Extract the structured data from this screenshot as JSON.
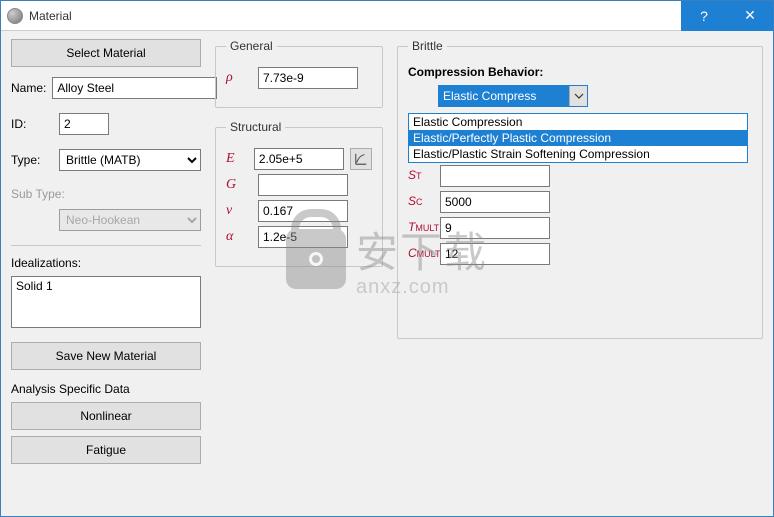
{
  "window": {
    "title": "Material"
  },
  "left": {
    "select_material": "Select Material",
    "name_label": "Name:",
    "name_value": "Alloy Steel",
    "id_label": "ID:",
    "id_value": "2",
    "type_label": "Type:",
    "type_value": "Brittle (MATB)",
    "subtype_label": "Sub Type:",
    "subtype_value": "Neo-Hookean",
    "idealizations_label": "Idealizations:",
    "idealizations_value": "Solid 1",
    "save_new": "Save New Material",
    "analysis_label": "Analysis Specific Data",
    "nonlinear": "Nonlinear",
    "fatigue": "Fatigue"
  },
  "general": {
    "legend": "General",
    "rho_sym": "ρ",
    "rho_value": "7.73e-9"
  },
  "structural": {
    "legend": "Structural",
    "E_sym": "E",
    "E_value": "2.05e+5",
    "G_sym": "G",
    "G_value": "",
    "nu_sym": "ν",
    "nu_value": "0.167",
    "alpha_sym": "α",
    "alpha_value": "1.2e-5"
  },
  "brittle": {
    "legend": "Brittle",
    "cb_label": "Compression Behavior:",
    "cb_selected": "Elastic Compress",
    "cb_options": [
      "Elastic Compression",
      "Elastic/Perfectly Plastic Compression",
      "Elastic/Plastic Strain Softening Compression"
    ],
    "cb_highlight_index": 1,
    "S_T_label": "S",
    "S_T_sub": "T",
    "S_T_value": "",
    "S_C_label": "S",
    "S_C_sub": "C",
    "S_C_value": "5000",
    "Tmult_label": "T",
    "Tmult_sub": "MULT",
    "Tmult_value": "9",
    "Cmult_label": "C",
    "Cmult_sub": "MULT",
    "Cmult_value": "12"
  },
  "watermark": {
    "cn": "安下载",
    "en": "anxz.com"
  }
}
